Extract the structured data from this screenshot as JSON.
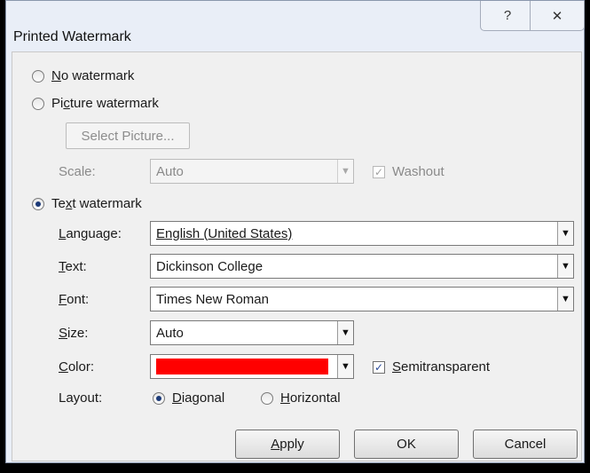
{
  "window": {
    "title": "Printed Watermark",
    "help_glyph": "?",
    "close_glyph": "✕"
  },
  "options": {
    "no_watermark": {
      "label_u": "N",
      "label_rest": "o watermark",
      "checked": false
    },
    "picture_watermark": {
      "label_pre": "Pi",
      "label_u": "c",
      "label_rest": "ture watermark",
      "checked": false
    },
    "text_watermark": {
      "label_pre": "Te",
      "label_u": "x",
      "label_rest": "t watermark",
      "checked": true
    }
  },
  "picture": {
    "select_button": "Select Picture...",
    "scale_label": "Scale:",
    "scale_value": "Auto",
    "washout_label": "Washout",
    "washout_checked": true
  },
  "text": {
    "language_label_u": "L",
    "language_label_rest": "anguage:",
    "language_value": "English (United States)",
    "text_label_u": "T",
    "text_label_rest": "ext:",
    "text_value": "Dickinson College",
    "font_label_u": "F",
    "font_label_rest": "ont:",
    "font_value": "Times New Roman",
    "size_label_u": "S",
    "size_label_rest": "ize:",
    "size_value": "Auto",
    "color_label_u": "C",
    "color_label_rest": "olor:",
    "color_value_hex": "#ff0000",
    "semitransparent_u": "S",
    "semitransparent_pre": "",
    "semitransparent_rest": "emitransparent",
    "semitransparent_checked": true,
    "layout_label": "Layout:",
    "diagonal_u": "D",
    "diagonal_rest": "iagonal",
    "diagonal_checked": true,
    "horizontal_u": "H",
    "horizontal_rest": "orizontal",
    "horizontal_checked": false
  },
  "buttons": {
    "apply_u": "A",
    "apply_rest": "pply",
    "ok": "OK",
    "cancel": "Cancel"
  },
  "icons": {
    "dropdown": "▼",
    "check": "✓"
  }
}
